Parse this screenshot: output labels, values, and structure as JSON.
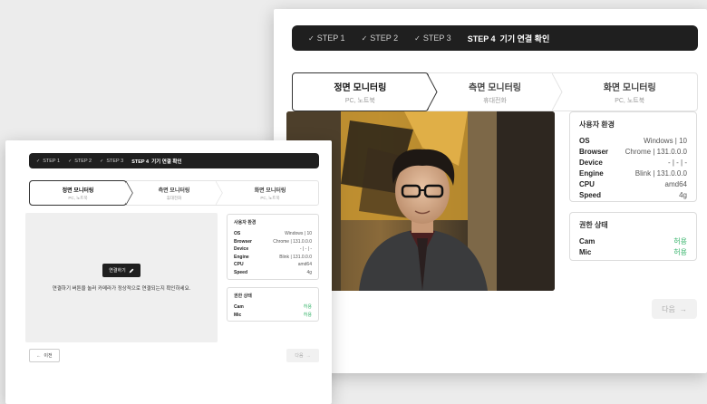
{
  "steps": [
    {
      "label": "STEP 1",
      "done": true
    },
    {
      "label": "STEP 2",
      "done": true
    },
    {
      "label": "STEP 3",
      "done": true
    },
    {
      "label": "STEP 4  기기 연결 확인",
      "done": false
    }
  ],
  "tabs": [
    {
      "title": "정면 모니터링",
      "sub": "PC, 노트북"
    },
    {
      "title": "측면 모니터링",
      "sub": "휴대전화"
    },
    {
      "title": "화면 모니터링",
      "sub": "PC, 노트북"
    }
  ],
  "env": {
    "title": "사용자 환경",
    "rows": [
      {
        "k": "OS",
        "v": "Windows | 10"
      },
      {
        "k": "Browser",
        "v": "Chrome | 131.0.0.0"
      },
      {
        "k": "Device",
        "v": "- | - | -"
      },
      {
        "k": "Engine",
        "v": "Blink | 131.0.0.0"
      },
      {
        "k": "CPU",
        "v": "amd64"
      },
      {
        "k": "Speed",
        "v": "4g"
      }
    ]
  },
  "perm": {
    "title": "권한 상태",
    "rows": [
      {
        "k": "Cam",
        "v": "허용"
      },
      {
        "k": "Mic",
        "v": "허용"
      }
    ]
  },
  "buttons": {
    "next": "다음",
    "prev": "이전",
    "connect": "연결하기"
  },
  "hint": "연결하기 버튼을 눌러 카메라가 정상적으로 연결되는지 확인하세요.",
  "colors": {
    "ok": "#36b36a",
    "bar": "#1f1f1f"
  }
}
